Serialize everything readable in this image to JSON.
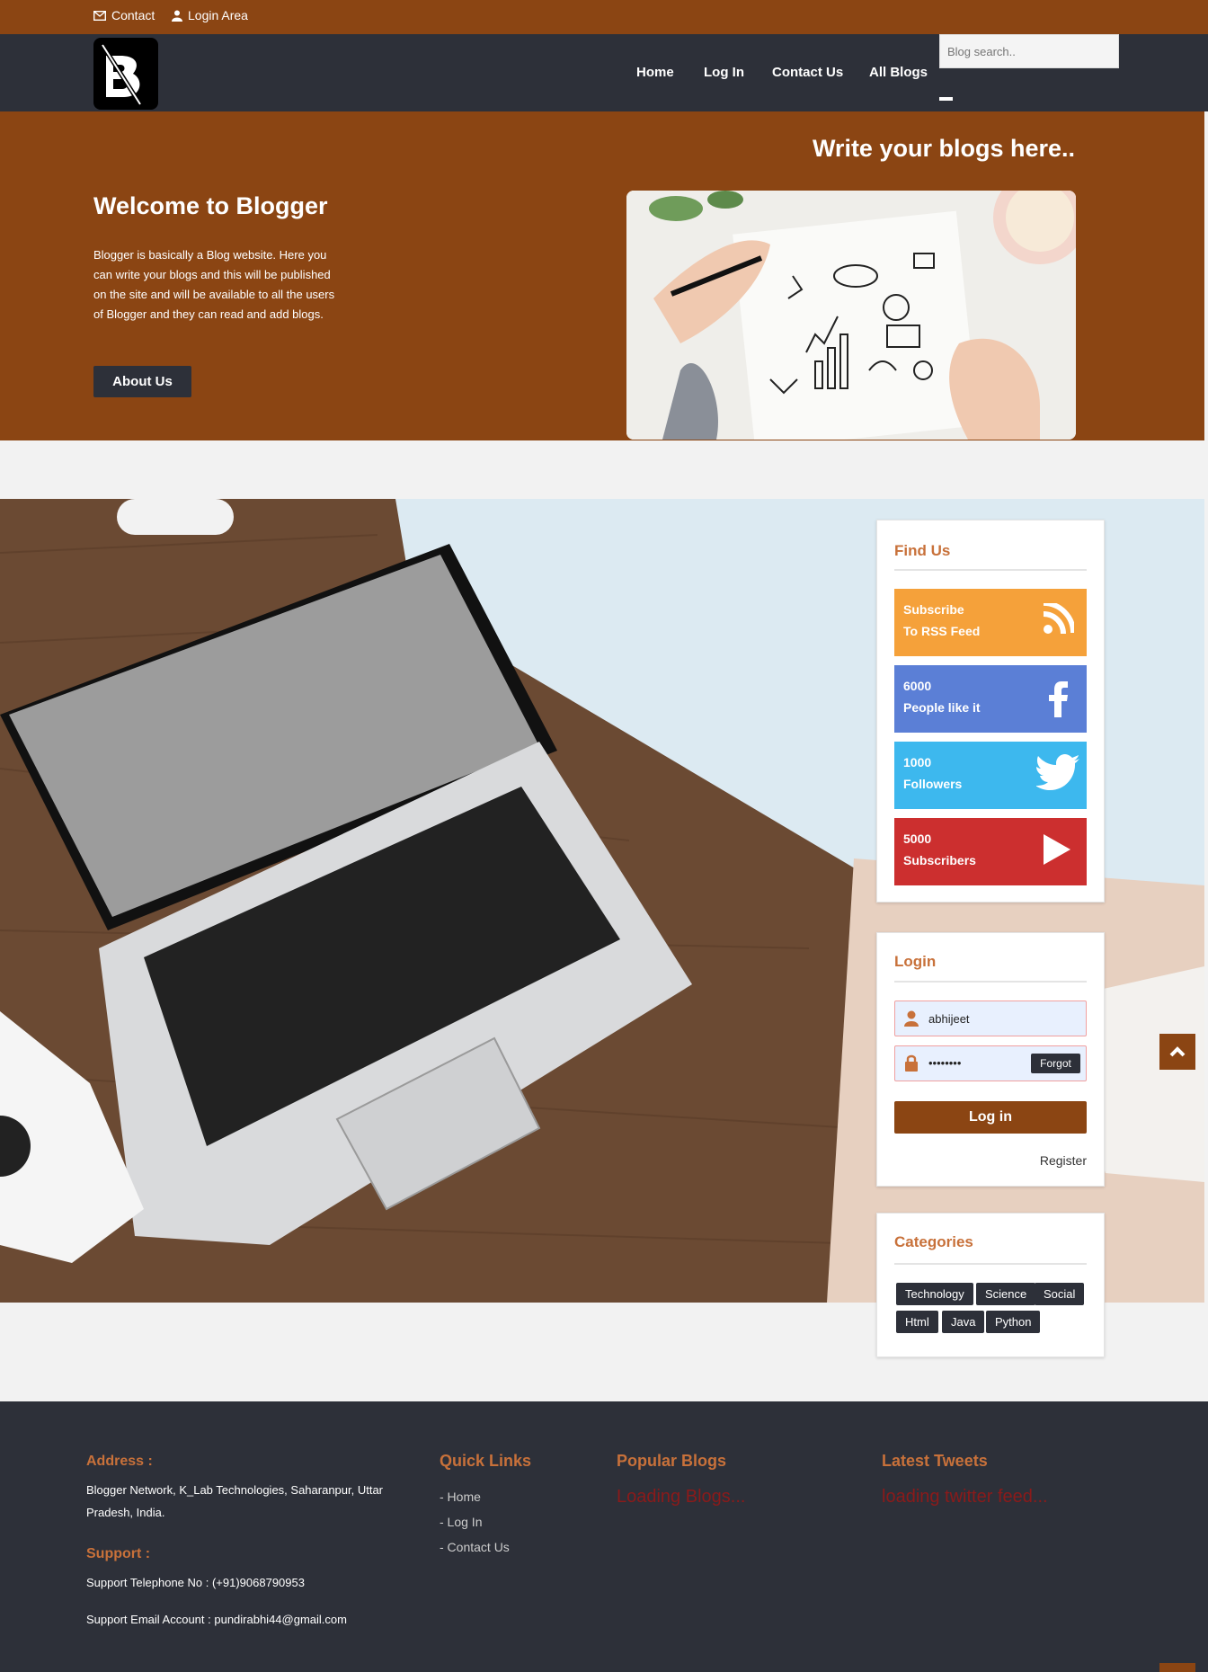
{
  "topbar": {
    "contact": "Contact",
    "login_area": "Login Area"
  },
  "nav": {
    "items": [
      "Home",
      "Log In",
      "Contact Us",
      "All Blogs"
    ],
    "search_placeholder": "Blog search.."
  },
  "hero": {
    "tagline": "Write your blogs here..",
    "title": "Welcome to Blogger",
    "text": "Blogger is basically a Blog website. Here you can write your blogs and this will be published on the site and will be available to all the users of Blogger and they can read and add blogs.",
    "about_button": "About Us"
  },
  "find_us": {
    "title": "Find Us",
    "items": [
      {
        "line1": "Subscribe",
        "line2": "To RSS Feed",
        "color": "#f5a13a",
        "icon": "rss-icon"
      },
      {
        "line1": "6000",
        "line2": "People like it",
        "color": "#5b7fd6",
        "icon": "facebook-icon"
      },
      {
        "line1": "1000",
        "line2": "Followers",
        "color": "#3db8ee",
        "icon": "twitter-icon"
      },
      {
        "line1": "5000",
        "line2": "Subscribers",
        "color": "#cc2f2f",
        "icon": "youtube-play-icon"
      }
    ]
  },
  "login": {
    "title": "Login",
    "username": "abhijeet",
    "password": "••••••••",
    "forgot": "Forgot",
    "button": "Log in",
    "register": "Register"
  },
  "categories": {
    "title": "Categories",
    "tags": [
      "Technology",
      "Science",
      "Social",
      "Html",
      "Java",
      "Python"
    ]
  },
  "footer": {
    "address_title": "Address :",
    "address": "Blogger Network, K_Lab Technologies, Saharanpur, Uttar Pradesh, India.",
    "support_title": "Support :",
    "phone": "Support Telephone No : (+91)9068790953",
    "email": "Support Email Account : pundirabhi44@gmail.com",
    "quick_links_title": "Quick Links",
    "quick_links": [
      "- Home",
      "- Log In",
      "- Contact Us"
    ],
    "popular_title": "Popular Blogs",
    "popular_loading": "Loading Blogs...",
    "tweets_title": "Latest Tweets",
    "tweets_loading": "loading twitter feed..."
  },
  "colors": {
    "brand_brown": "#8b4513",
    "dark": "#2d3039",
    "accent_orange": "#c8713a"
  }
}
